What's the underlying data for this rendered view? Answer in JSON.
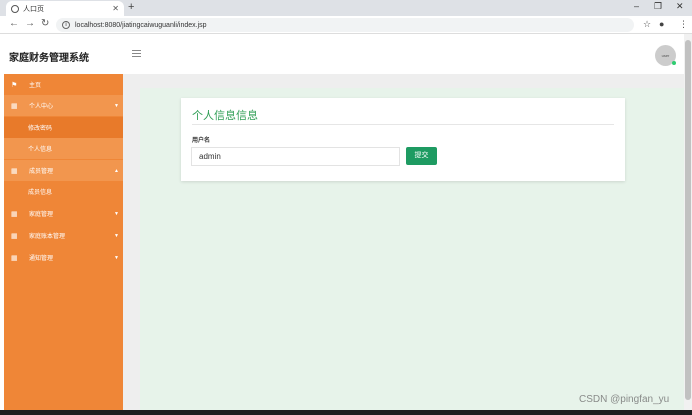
{
  "browser": {
    "tab_title": "人口页",
    "new_tab": "+",
    "url": "localhost:8080/jiatingcaiwuguanli/index.jsp",
    "win_min": "–",
    "win_max": "❐",
    "win_close": "✕"
  },
  "app": {
    "brand": "家庭财务管理系统",
    "avatar_text": "user"
  },
  "sidebar": {
    "items": [
      {
        "label": "主页"
      },
      {
        "label": "个人中心"
      },
      {
        "label": "修改密码"
      },
      {
        "label": "个人信息"
      },
      {
        "label": "成员管理"
      },
      {
        "label": "成员信息"
      },
      {
        "label": "家庭管理"
      },
      {
        "label": "家庭账本管理"
      },
      {
        "label": "通知管理"
      }
    ]
  },
  "form": {
    "title": "个人信息信息",
    "username_label": "用户名",
    "username_value": "admin",
    "submit_label": "提交"
  },
  "watermark": "CSDN @pingfan_yu",
  "colors": {
    "sidebar": "#ef8637",
    "accent": "#2f9e55",
    "submit": "#1e9b62"
  }
}
